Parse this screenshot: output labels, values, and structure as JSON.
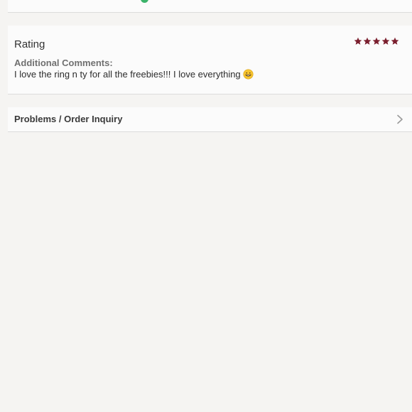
{
  "colors": {
    "star": "#7b1f2e",
    "status_dot": "#3cb36a",
    "chevron": "#9a9a9a"
  },
  "rating": {
    "title": "Rating",
    "stars": 5,
    "max_stars": 5,
    "comments_label": "Additional Comments:",
    "comments_text": "I love the ring n ty for all the freebies!!! I love everything",
    "emoji_icon": "grinning-face-icon"
  },
  "problems": {
    "label": "Problems / Order Inquiry",
    "chevron_icon": "chevron-right-icon"
  }
}
